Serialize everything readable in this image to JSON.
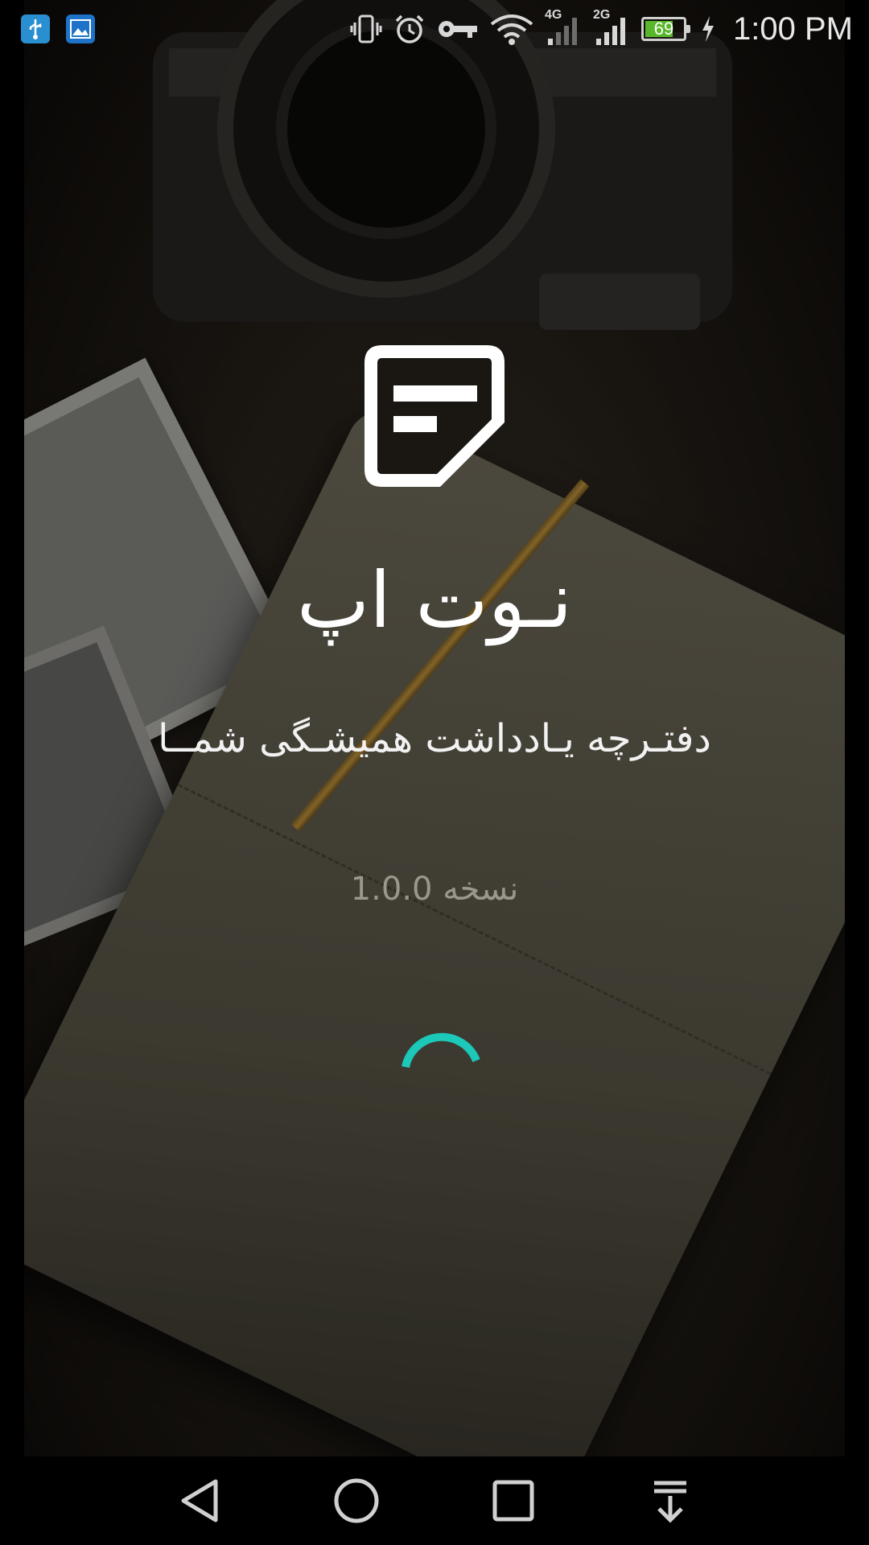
{
  "status_bar": {
    "time": "1:00 PM",
    "battery_level": "69",
    "network_a": "4G",
    "network_b": "2G",
    "icons": [
      "usb-icon",
      "gallery-icon",
      "vibrate-icon",
      "alarm-icon",
      "vpn-key-icon",
      "wifi-icon",
      "signal-4g-icon",
      "signal-2g-icon",
      "battery-icon",
      "charging-icon"
    ]
  },
  "splash": {
    "app_title": "نـوت اپ",
    "tagline": "دفتـرچه یـادداشت همیشـگی شمــا",
    "version": "نسخه 1.0.0",
    "logo_icon": "note-icon",
    "loading_icon": "loading-spinner-icon",
    "accent_color": "#1cc8b8"
  },
  "nav_bar": {
    "icons": [
      "back-icon",
      "home-icon",
      "recents-icon",
      "notification-pull-icon"
    ]
  }
}
